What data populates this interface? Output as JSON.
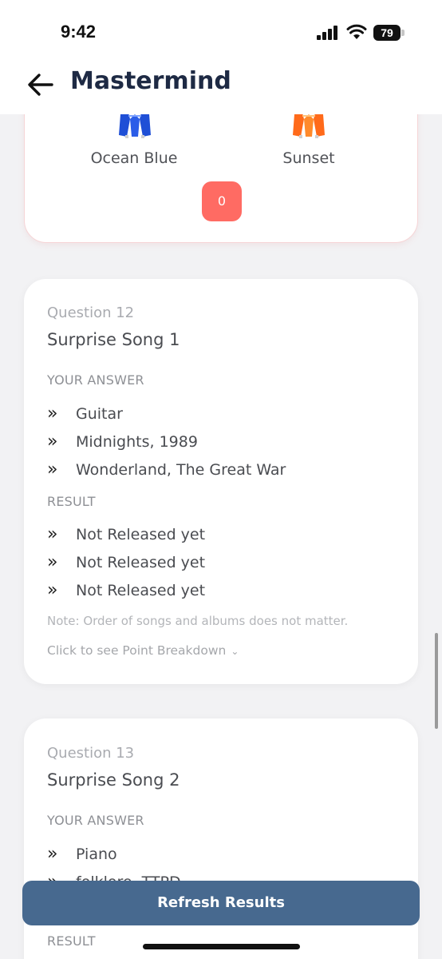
{
  "status_bar": {
    "time": "9:42",
    "battery": "79"
  },
  "header": {
    "title": "Mastermind"
  },
  "theme_card": {
    "themes": [
      {
        "label": "Ocean Blue",
        "color": "#1f4fd6"
      },
      {
        "label": "Sunset",
        "color": "#ff7a1f"
      }
    ],
    "score": "0"
  },
  "questions": [
    {
      "number": "Question 12",
      "title": "Surprise Song 1",
      "answer_heading": "YOUR ANSWER",
      "answers": [
        "Guitar",
        "Midnights, 1989",
        "Wonderland, The Great War"
      ],
      "result_heading": "RESULT",
      "results": [
        "Not Released yet",
        "Not Released yet",
        "Not Released yet"
      ],
      "note": "Note: Order of songs and albums does not matter.",
      "breakdown": "Click to see Point Breakdown"
    },
    {
      "number": "Question 13",
      "title": "Surprise Song 2",
      "answer_heading": "YOUR ANSWER",
      "answers": [
        "Piano",
        "folklore, TTPD"
      ],
      "result_heading": "RESULT"
    }
  ],
  "refresh_button": "Refresh Results"
}
